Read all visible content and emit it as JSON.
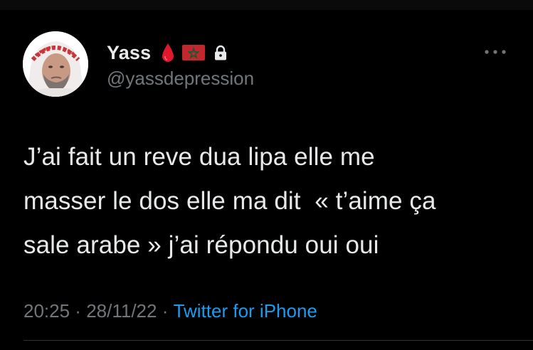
{
  "tweet": {
    "author": {
      "display_name": "Yass",
      "handle": "@yassdepression",
      "badges": [
        "blood-drop-icon",
        "morocco-flag-icon",
        "lock-icon"
      ]
    },
    "text": "J’ai fait un reve dua lipa elle me\nmasser le dos elle ma dit  « t’aime ça\nsale arabe » j’ai répondu oui oui",
    "time": "20:25",
    "separator": " · ",
    "date": "28/11/22",
    "source": "Twitter for iPhone"
  },
  "colors": {
    "background": "#000000",
    "primary_text": "#e7e9ea",
    "secondary_text": "#71767b",
    "link": "#1d9bf0",
    "drop": "#e0182d",
    "flag_red": "#c1272d",
    "flag_green": "#006233"
  }
}
